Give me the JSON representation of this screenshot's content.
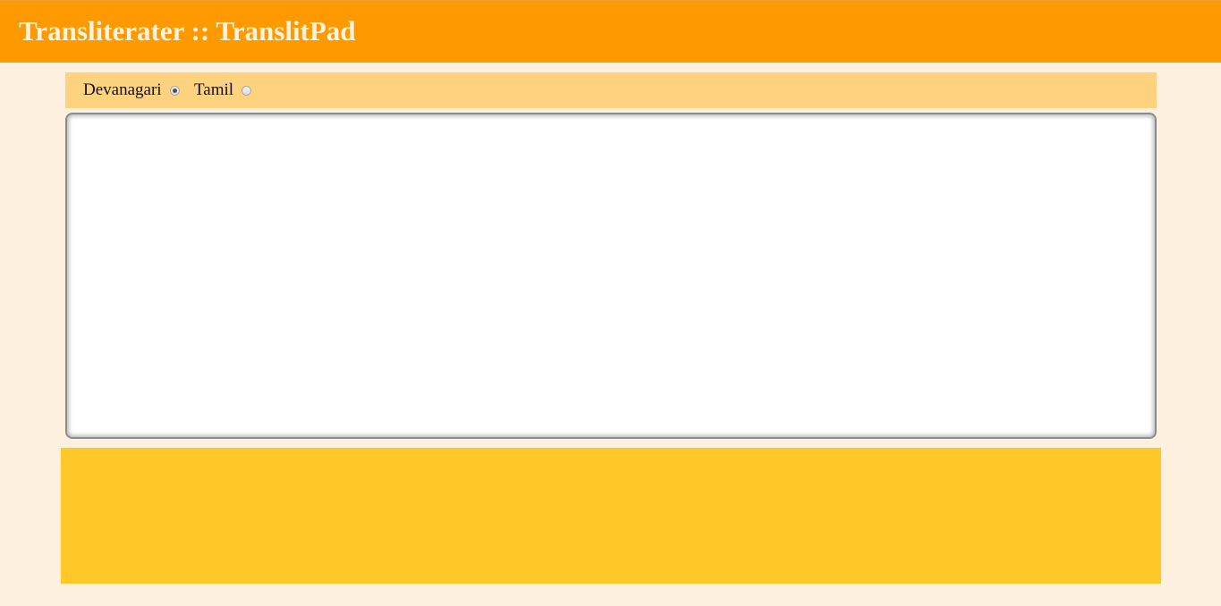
{
  "header": {
    "title": "Transliterater :: TranslitPad"
  },
  "script_selector": {
    "options": [
      {
        "label": "Devanagari",
        "checked": true
      },
      {
        "label": "Tamil",
        "checked": false
      }
    ]
  },
  "editor": {
    "value": "",
    "placeholder": ""
  },
  "colors": {
    "header_bg": "#ff9900",
    "page_bg": "#fef0de",
    "selector_bg": "#ffd280",
    "footer_panel_bg": "#ffc828"
  }
}
